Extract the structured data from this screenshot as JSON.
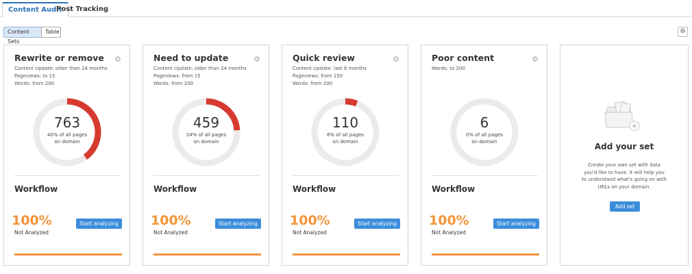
{
  "tabs": [
    "Content Audit",
    "Post Tracking"
  ],
  "segments": [
    "Content Sets",
    "Table"
  ],
  "colors": {
    "accent": "#3c8ddb",
    "donut_fill": "#d63a2f",
    "donut_track": "#ebebeb",
    "workflow": "#f2953a"
  },
  "cards": [
    {
      "title": "Rewrite or remove",
      "lines": [
        "Content Update: older than 24 months",
        "Pageviews: to 15",
        "Words: from 200"
      ],
      "count": "763",
      "share_fraction": 0.4,
      "share_line1": "40% of all pages",
      "share_line2": "on domain",
      "workflow": "Workflow",
      "percent": "100%",
      "status": "Not Analyzed",
      "button": "Start analyzing"
    },
    {
      "title": "Need to update",
      "lines": [
        "Content Update: older than 24 months",
        "Pageviews: from 15",
        "Words: from 200"
      ],
      "count": "459",
      "share_fraction": 0.24,
      "share_line1": "24% of all pages",
      "share_line2": "on domain",
      "workflow": "Workflow",
      "percent": "100%",
      "status": "Not Analyzed",
      "button": "Start analyzing"
    },
    {
      "title": "Quick review",
      "lines": [
        "Content Update: last 6 months",
        "Pageviews: from 150",
        "Words: from 200"
      ],
      "count": "110",
      "share_fraction": 0.06,
      "share_line1": "6% of all pages",
      "share_line2": "on domain",
      "workflow": "Workflow",
      "percent": "100%",
      "status": "Not Analyzed",
      "button": "Start analyzing"
    },
    {
      "title": "Poor content",
      "lines": [
        "Words: to 200"
      ],
      "count": "6",
      "share_fraction": 0.0,
      "share_line1": "0% of all pages",
      "share_line2": "on domain",
      "workflow": "Workflow",
      "percent": "100%",
      "status": "Not Analyzed",
      "button": "Start analyzing"
    }
  ],
  "add_set": {
    "title": "Add your set",
    "description": "Create your own set with data you'd like to have. It will help you to understand what's going on with URLs on your domain.",
    "button": "Add set"
  }
}
